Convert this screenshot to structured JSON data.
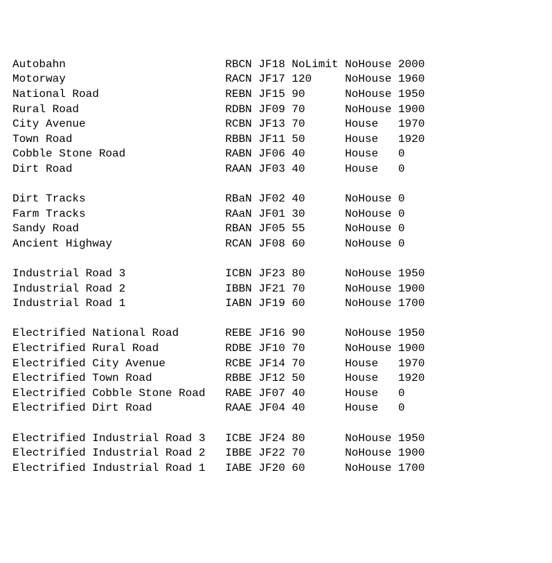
{
  "columns": {
    "name_width": 32,
    "code_width": 5,
    "id_width": 5,
    "speed_width": 8,
    "house_width": 8,
    "year_width": 5
  },
  "groups": [
    {
      "rows": [
        {
          "name": "Autobahn",
          "code": "RBCN",
          "id": "JF18",
          "speed": "NoLimit",
          "house": "NoHouse",
          "year": "2000"
        },
        {
          "name": "Motorway",
          "code": "RACN",
          "id": "JF17",
          "speed": "120",
          "house": "NoHouse",
          "year": "1960"
        },
        {
          "name": "National Road",
          "code": "REBN",
          "id": "JF15",
          "speed": "90",
          "house": "NoHouse",
          "year": "1950"
        },
        {
          "name": "Rural Road",
          "code": "RDBN",
          "id": "JF09",
          "speed": "70",
          "house": "NoHouse",
          "year": "1900"
        },
        {
          "name": "City Avenue",
          "code": "RCBN",
          "id": "JF13",
          "speed": "70",
          "house": "House",
          "year": "1970"
        },
        {
          "name": "Town Road",
          "code": "RBBN",
          "id": "JF11",
          "speed": "50",
          "house": "House",
          "year": "1920"
        },
        {
          "name": "Cobble Stone Road",
          "code": "RABN",
          "id": "JF06",
          "speed": "40",
          "house": "House",
          "year": "0"
        },
        {
          "name": "Dirt Road",
          "code": "RAAN",
          "id": "JF03",
          "speed": "40",
          "house": "House",
          "year": "0"
        }
      ]
    },
    {
      "rows": [
        {
          "name": "Dirt Tracks",
          "code": "RBaN",
          "id": "JF02",
          "speed": "40",
          "house": "NoHouse",
          "year": "0"
        },
        {
          "name": "Farm Tracks",
          "code": "RAaN",
          "id": "JF01",
          "speed": "30",
          "house": "NoHouse",
          "year": "0"
        },
        {
          "name": "Sandy Road",
          "code": "RBAN",
          "id": "JF05",
          "speed": "55",
          "house": "NoHouse",
          "year": "0"
        },
        {
          "name": "Ancient Highway",
          "code": "RCAN",
          "id": "JF08",
          "speed": "60",
          "house": "NoHouse",
          "year": "0"
        }
      ]
    },
    {
      "rows": [
        {
          "name": "Industrial Road 3",
          "code": "ICBN",
          "id": "JF23",
          "speed": "80",
          "house": "NoHouse",
          "year": "1950"
        },
        {
          "name": "Industrial Road 2",
          "code": "IBBN",
          "id": "JF21",
          "speed": "70",
          "house": "NoHouse",
          "year": "1900"
        },
        {
          "name": "Industrial Road 1",
          "code": "IABN",
          "id": "JF19",
          "speed": "60",
          "house": "NoHouse",
          "year": "1700"
        }
      ]
    },
    {
      "rows": [
        {
          "name": "Electrified National Road",
          "code": "REBE",
          "id": "JF16",
          "speed": "90",
          "house": "NoHouse",
          "year": "1950"
        },
        {
          "name": "Electrified Rural Road",
          "code": "RDBE",
          "id": "JF10",
          "speed": "70",
          "house": "NoHouse",
          "year": "1900"
        },
        {
          "name": "Electrified City Avenue",
          "code": "RCBE",
          "id": "JF14",
          "speed": "70",
          "house": "House",
          "year": "1970"
        },
        {
          "name": "Electrified Town Road",
          "code": "RBBE",
          "id": "JF12",
          "speed": "50",
          "house": "House",
          "year": "1920"
        },
        {
          "name": "Electrified Cobble Stone Road",
          "code": "RABE",
          "id": "JF07",
          "speed": "40",
          "house": "House",
          "year": "0"
        },
        {
          "name": "Electrified Dirt Road",
          "code": "RAAE",
          "id": "JF04",
          "speed": "40",
          "house": "House",
          "year": "0"
        }
      ]
    },
    {
      "rows": [
        {
          "name": "Electrified Industrial Road 3",
          "code": "ICBE",
          "id": "JF24",
          "speed": "80",
          "house": "NoHouse",
          "year": "1950"
        },
        {
          "name": "Electrified Industrial Road 2",
          "code": "IBBE",
          "id": "JF22",
          "speed": "70",
          "house": "NoHouse",
          "year": "1900"
        },
        {
          "name": "Electrified Industrial Road 1",
          "code": "IABE",
          "id": "JF20",
          "speed": "60",
          "house": "NoHouse",
          "year": "1700"
        }
      ]
    }
  ]
}
